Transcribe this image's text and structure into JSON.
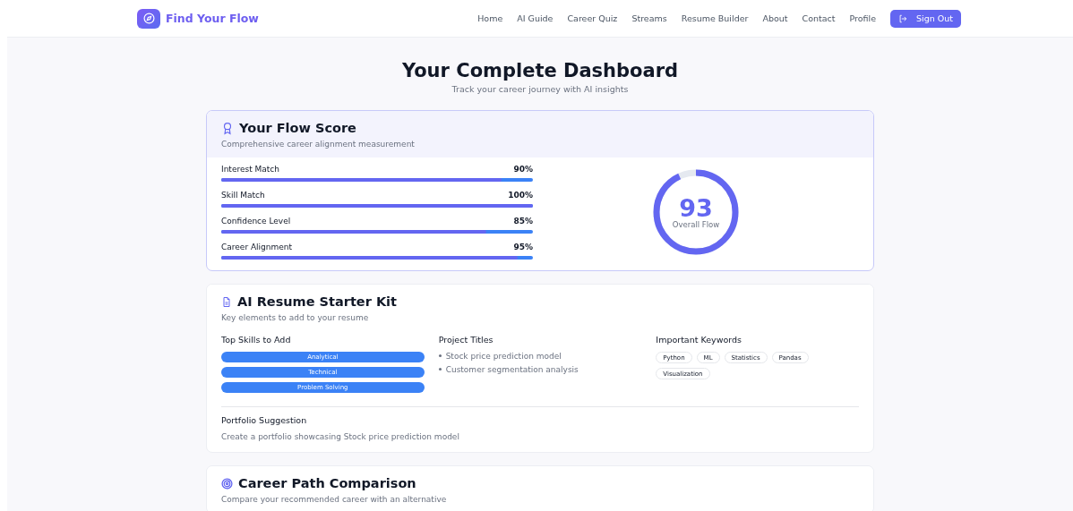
{
  "header": {
    "brand": "Find Your Flow",
    "nav": [
      {
        "label": "Home"
      },
      {
        "label": "AI Guide"
      },
      {
        "label": "Career Quiz"
      },
      {
        "label": "Streams"
      },
      {
        "label": "Resume Builder"
      },
      {
        "label": "About"
      },
      {
        "label": "Contact"
      },
      {
        "label": "Profile"
      }
    ],
    "sign_out": "Sign Out"
  },
  "page": {
    "title": "Your Complete Dashboard",
    "subtitle": "Track your career journey with AI insights"
  },
  "flow_score": {
    "title": "Your Flow Score",
    "subtitle": "Comprehensive career alignment measurement",
    "metrics": [
      {
        "label": "Interest Match",
        "reading": "90%",
        "level": 0.9
      },
      {
        "label": "Skill Match",
        "reading": "100%",
        "level": 1
      },
      {
        "label": "Confidence Level",
        "reading": "85%",
        "level": 0.85
      },
      {
        "label": "Career Alignment",
        "reading": "95%",
        "level": 0.95
      }
    ],
    "overall": {
      "value": "93",
      "label": "Overall Flow"
    }
  },
  "resume_kit": {
    "title": "AI Resume Starter Kit",
    "subtitle": "Key elements to add to your resume",
    "skills_heading": "Top Skills to Add",
    "skills": [
      "Analytical",
      "Technical",
      "Problem Solving"
    ],
    "projects_heading": "Project Titles",
    "projects": [
      "Stock price prediction model",
      "Customer segmentation analysis"
    ],
    "keywords_heading": "Important Keywords",
    "keywords": [
      "Python",
      "ML",
      "Statistics",
      "Pandas",
      "Visualization"
    ],
    "portfolio_heading": "Portfolio Suggestion",
    "portfolio": "Create a portfolio showcasing Stock price prediction model"
  },
  "comparison": {
    "title": "Career Path Comparison",
    "subtitle": "Compare your recommended career with an alternative"
  }
}
